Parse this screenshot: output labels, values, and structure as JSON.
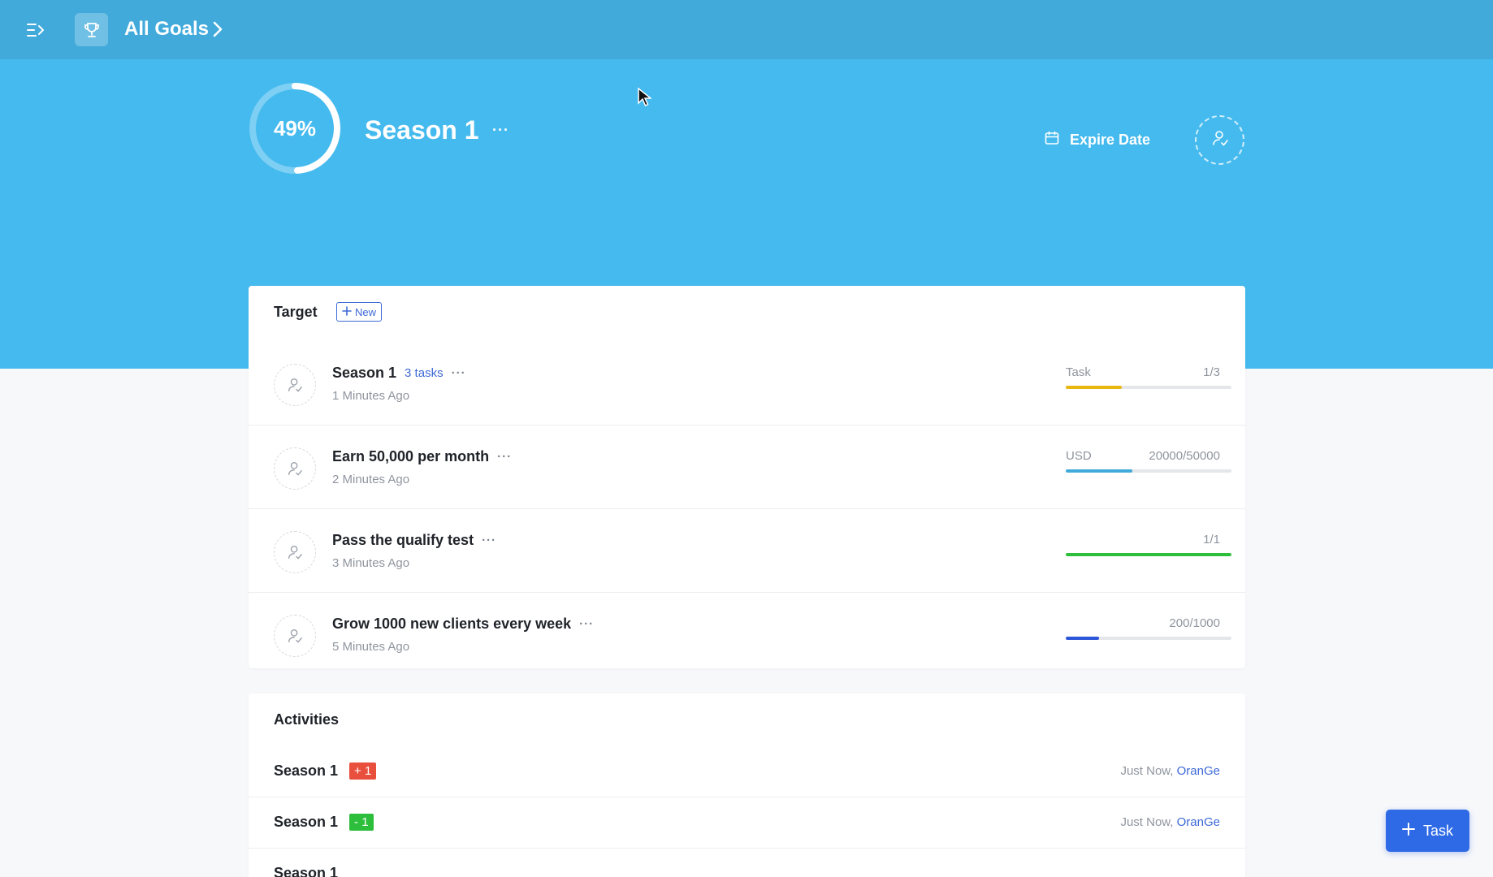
{
  "topbar": {
    "breadcrumb_title": "All Goals",
    "menu_icon": "sidebar-toggle-icon",
    "trophy_icon": "trophy-icon"
  },
  "goal": {
    "progress_label": "49%",
    "progress_fraction": 0.49,
    "title": "Season 1",
    "more_label": "···",
    "expire_label": "Expire Date"
  },
  "target": {
    "heading": "Target",
    "new_label": "New",
    "items": [
      {
        "title": "Season 1",
        "tasks_label": "3 tasks",
        "more": "···",
        "time": "1 Minutes Ago",
        "unit": "Task",
        "value": "1/3",
        "progress": 0.34,
        "color": "#e8b710"
      },
      {
        "title": "Earn 50,000 per month",
        "tasks_label": "",
        "more": "···",
        "time": "2 Minutes Ago",
        "unit": "USD",
        "value": "20000/50000",
        "progress": 0.4,
        "color": "#41aadb"
      },
      {
        "title": "Pass the qualify test",
        "tasks_label": "",
        "more": "···",
        "time": "3 Minutes Ago",
        "unit": "",
        "value": "1/1",
        "progress": 1.0,
        "color": "#2dbf3c"
      },
      {
        "title": "Grow 1000 new clients every week",
        "tasks_label": "",
        "more": "···",
        "time": "5 Minutes Ago",
        "unit": "",
        "value": "200/1000",
        "progress": 0.2,
        "color": "#2d55d9"
      }
    ]
  },
  "activities": {
    "heading": "Activities",
    "items": [
      {
        "name": "Season 1",
        "badge": "+ 1",
        "badge_color": "#e84f3d",
        "time": "Just Now,",
        "user": "OranGe"
      },
      {
        "name": "Season 1",
        "badge": "- 1",
        "badge_color": "#2dbf3c",
        "time": "Just Now,",
        "user": "OranGe"
      },
      {
        "name": "Season 1",
        "badge": "",
        "badge_color": "",
        "time": "",
        "user": ""
      }
    ]
  },
  "fab": {
    "label": "Task"
  }
}
